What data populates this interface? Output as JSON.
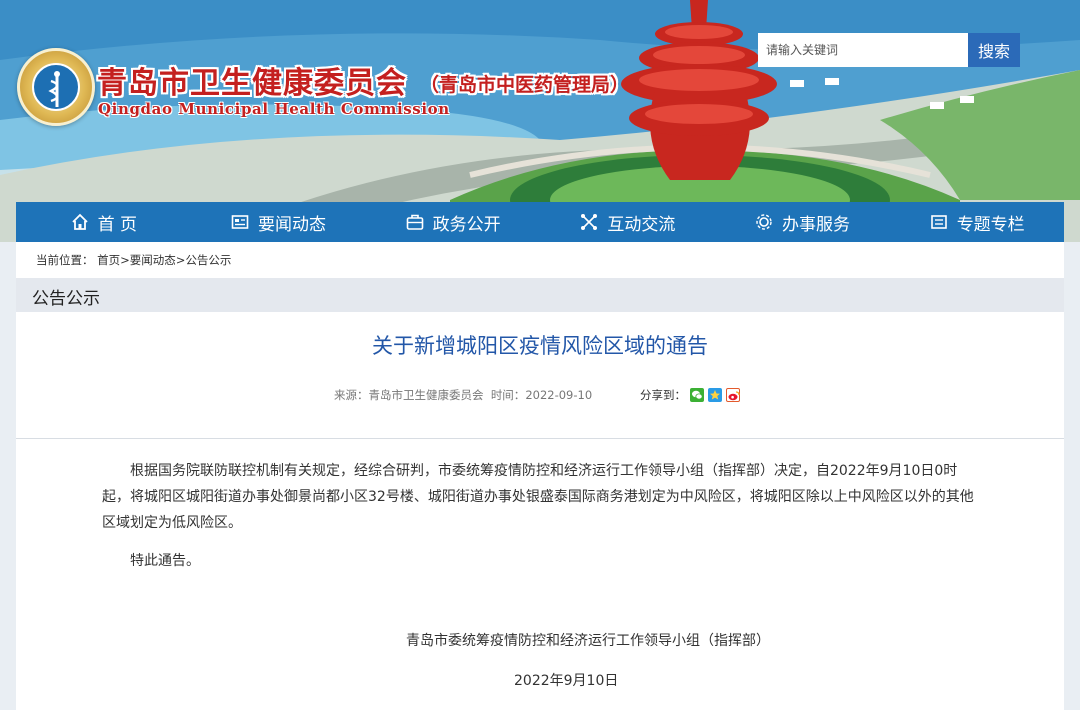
{
  "header": {
    "title": "青岛市卫生健康委员会",
    "subtitle": "（青岛市中医药管理局）",
    "english": "Qingdao Municipal Health Commission",
    "search_placeholder": "请输入关键词",
    "search_button": "搜索"
  },
  "nav": {
    "items": [
      {
        "label": "首 页",
        "icon": "home-icon"
      },
      {
        "label": "要闻动态",
        "icon": "news-icon"
      },
      {
        "label": "政务公开",
        "icon": "briefcase-icon"
      },
      {
        "label": "互动交流",
        "icon": "interaction-icon"
      },
      {
        "label": "办事服务",
        "icon": "service-icon"
      },
      {
        "label": "专题专栏",
        "icon": "topic-icon"
      }
    ]
  },
  "breadcrumb": {
    "prefix": "当前位置：",
    "items": [
      "首页",
      "要闻动态",
      "公告公示"
    ],
    "separator": ">"
  },
  "section": {
    "title": "公告公示"
  },
  "article": {
    "title": "关于新增城阳区疫情风险区域的通告",
    "source_label": "来源：",
    "source": "青岛市卫生健康委员会",
    "time_label": "时间：",
    "time": "2022-09-10",
    "share_label": "分享到：",
    "share_icons": [
      "wechat-icon",
      "qzone-icon",
      "weibo-icon"
    ],
    "paragraph1": "根据国务院联防联控机制有关规定，经综合研判，市委统筹疫情防控和经济运行工作领导小组（指挥部）决定，自2022年9月10日0时起，将城阳区城阳街道办事处御景尚都小区32号楼、城阳街道办事处银盛泰国际商务港划定为中风险区，将城阳区除以上中风险区以外的其他区域划定为低风险区。",
    "paragraph2": "特此通告。",
    "signature": "青岛市委统筹疫情防控和经济运行工作领导小组（指挥部）",
    "date": "2022年9月10日"
  },
  "colors": {
    "nav_bg": "#1e73b8",
    "title_red": "#c4201f",
    "article_title": "#2357a8",
    "search_button": "#2b6ab8"
  }
}
